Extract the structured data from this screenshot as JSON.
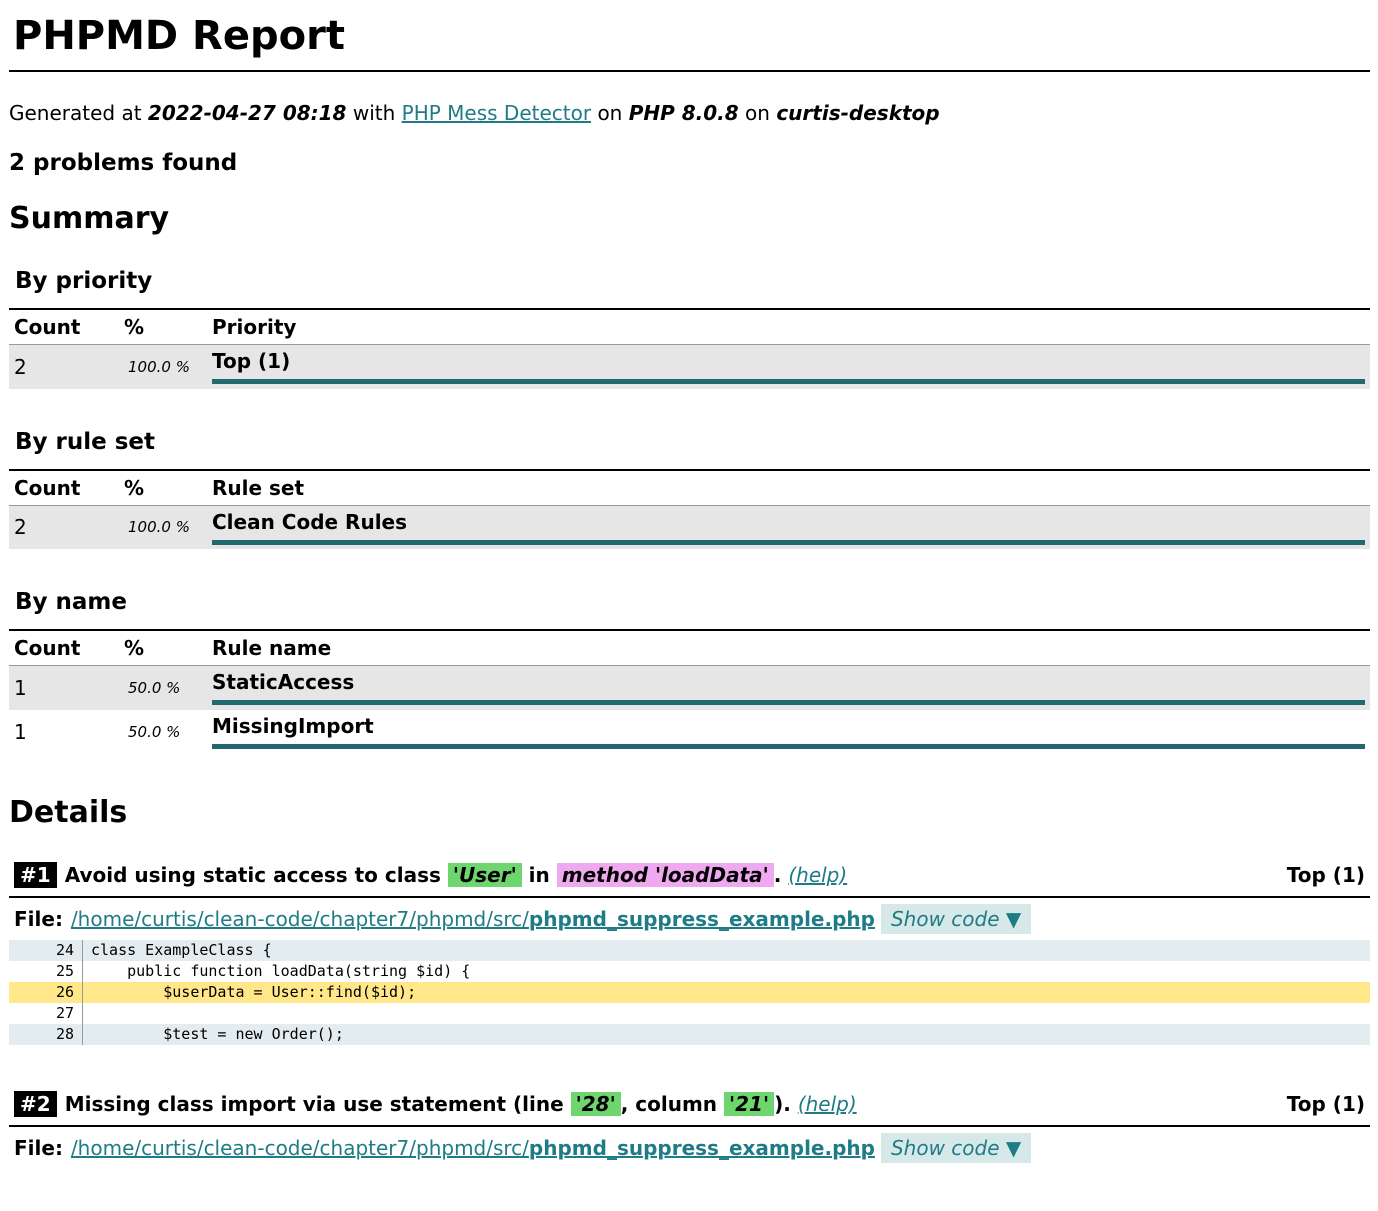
{
  "title": "PHPMD Report",
  "generated": {
    "prefix": "Generated at",
    "date": "2022-04-27 08:18",
    "with": "with",
    "tool": "PHP Mess Detector",
    "on1": "on",
    "php": "PHP 8.0.8",
    "on2": "on",
    "host": "curtis-desktop"
  },
  "problems": "2 problems found",
  "summary_heading": "Summary",
  "by_priority": {
    "heading": "By priority",
    "columns": [
      "Count",
      "%",
      "Priority"
    ],
    "rows": [
      {
        "count": "2",
        "pct": "100.0 %",
        "name": "Top (1)",
        "fraction": 1.0
      }
    ]
  },
  "by_ruleset": {
    "heading": "By rule set",
    "columns": [
      "Count",
      "%",
      "Rule set"
    ],
    "rows": [
      {
        "count": "2",
        "pct": "100.0 %",
        "name": "Clean Code Rules",
        "fraction": 1.0
      }
    ]
  },
  "by_name": {
    "heading": "By name",
    "columns": [
      "Count",
      "%",
      "Rule name"
    ],
    "rows": [
      {
        "count": "1",
        "pct": "50.0 %",
        "name": "StaticAccess",
        "fraction": 1.0
      },
      {
        "count": "1",
        "pct": "50.0 %",
        "name": "MissingImport",
        "fraction": 1.0
      }
    ]
  },
  "details_heading": "Details",
  "details": [
    {
      "num": "#1",
      "msg_a": "Avoid using static access to class",
      "class": "'User'",
      "msg_b": "in",
      "method": "method 'loadData'",
      "msg_c": ".",
      "help": "(help)",
      "priority": "Top (1)",
      "file_label": "File:",
      "path": "/home/curtis/clean-code/chapter7/phpmd/src/",
      "filename": "phpmd_suppress_example.php",
      "show": "Show code ▼",
      "code": [
        {
          "ln": "24",
          "src": "class ExampleClass {"
        },
        {
          "ln": "25",
          "src": "    public function loadData(string $id) {"
        },
        {
          "ln": "26",
          "src": "        $userData = User::find($id);"
        },
        {
          "ln": "27",
          "src": ""
        },
        {
          "ln": "28",
          "src": "        $test = new Order();"
        }
      ]
    },
    {
      "num": "#2",
      "msg_a": "Missing class import via use statement (line",
      "line": "'28'",
      "msg_b": ", column",
      "column": "'21'",
      "msg_c": ").",
      "help": "(help)",
      "priority": "Top (1)",
      "file_label": "File:",
      "path": "/home/curtis/clean-code/chapter7/phpmd/src/",
      "filename": "phpmd_suppress_example.php",
      "show": "Show code ▼"
    }
  ]
}
